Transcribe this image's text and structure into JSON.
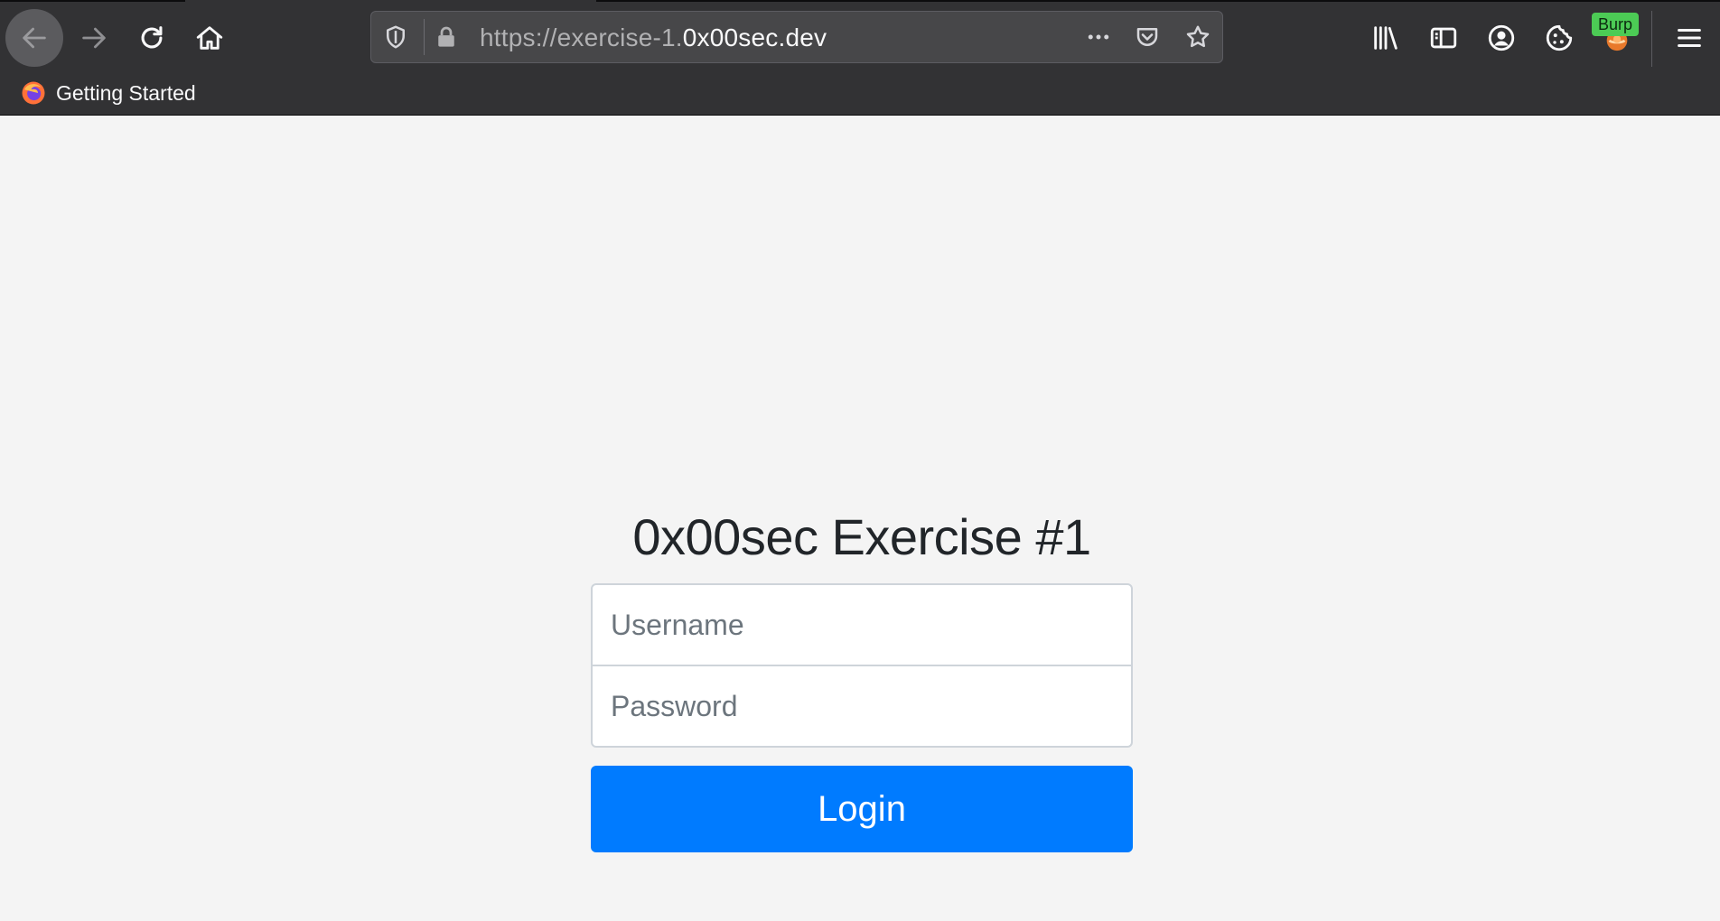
{
  "browser": {
    "url_prefix": "https://exercise-1.",
    "url_host": "0x00sec.dev",
    "burp_badge": "Burp",
    "bookmarks": [
      {
        "label": "Getting Started",
        "icon": "firefox-icon"
      }
    ],
    "toolbar_icons": [
      "back-icon",
      "forward-icon",
      "reload-icon",
      "home-icon",
      "shield-icon",
      "lock-icon",
      "more-icon",
      "pocket-icon",
      "star-icon",
      "library-icon",
      "sidebar-icon",
      "account-icon",
      "cookie-icon",
      "burp-icon",
      "menu-icon"
    ]
  },
  "page": {
    "title": "0x00sec Exercise #1",
    "username_placeholder": "Username",
    "password_placeholder": "Password",
    "login_label": "Login",
    "accent_color": "#007bff"
  }
}
